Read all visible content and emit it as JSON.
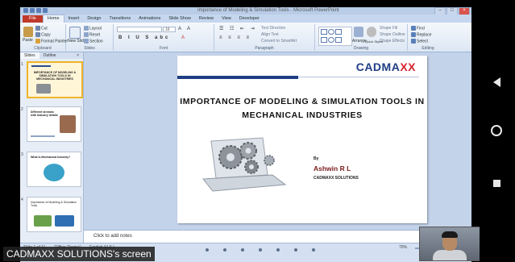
{
  "app": {
    "window_title": "Importance of Modeling & Simulation Tools - Microsoft PowerPoint",
    "tabs": [
      "File",
      "Home",
      "Insert",
      "Design",
      "Transitions",
      "Animations",
      "Slide Show",
      "Review",
      "View",
      "Developer"
    ],
    "active_tab": "Home"
  },
  "ribbon": {
    "clipboard": {
      "paste": "Paste",
      "cut": "Cut",
      "copy": "Copy",
      "format_painter": "Format Painter",
      "label": "Clipboard"
    },
    "slides": {
      "new_slide": "New Slide",
      "layout": "Layout",
      "reset": "Reset",
      "section": "Section",
      "label": "Slides"
    },
    "font": {
      "size": "16",
      "label": "Font"
    },
    "paragraph": {
      "text_direction": "Text Direction",
      "align_text": "Align Text",
      "convert_smartart": "Convert to SmartArt",
      "label": "Paragraph"
    },
    "drawing": {
      "arrange": "Arrange",
      "quick_styles": "Quick Styles",
      "shape_fill": "Shape Fill",
      "shape_outline": "Shape Outline",
      "shape_effects": "Shape Effects",
      "label": "Drawing"
    },
    "editing": {
      "find": "Find",
      "replace": "Replace",
      "select": "Select",
      "label": "Editing"
    }
  },
  "pane": {
    "tabs": [
      "Slides",
      "Outline"
    ],
    "close": "×",
    "thumbnails": [
      {
        "num": "1",
        "title": "IMPORTANCE OF MODELING & SIMULATION TOOLS IN MECHANICAL INDUSTRIES"
      },
      {
        "num": "2",
        "title": "Different streams with Industry details"
      },
      {
        "num": "3",
        "title": "What is Mechanical Industry?"
      },
      {
        "num": "4",
        "title": "Importance of Modeling & Simulation Tools"
      }
    ]
  },
  "slide": {
    "logo_main": "CADMA",
    "logo_accent": "XX",
    "title": "IMPORTANCE OF MODELING & SIMULATION TOOLS IN MECHANICAL INDUSTRIES",
    "by": "By",
    "author": "Ashwin R L",
    "company": "CADMAXX SOLUTIONS"
  },
  "notes": {
    "placeholder": "Click to add notes"
  },
  "status": {
    "slide_count": "Slide 1 of 11",
    "theme": "\"Office Theme\"",
    "language": "English (U.S.)",
    "zoom": "70%"
  },
  "share": {
    "banner": "CADMAXX SOLUTIONS's screen"
  },
  "colors": {
    "brand_blue": "#1f3e85",
    "brand_red": "#d7262e",
    "file_tab": "#c0392b",
    "selection": "#f0b429"
  }
}
